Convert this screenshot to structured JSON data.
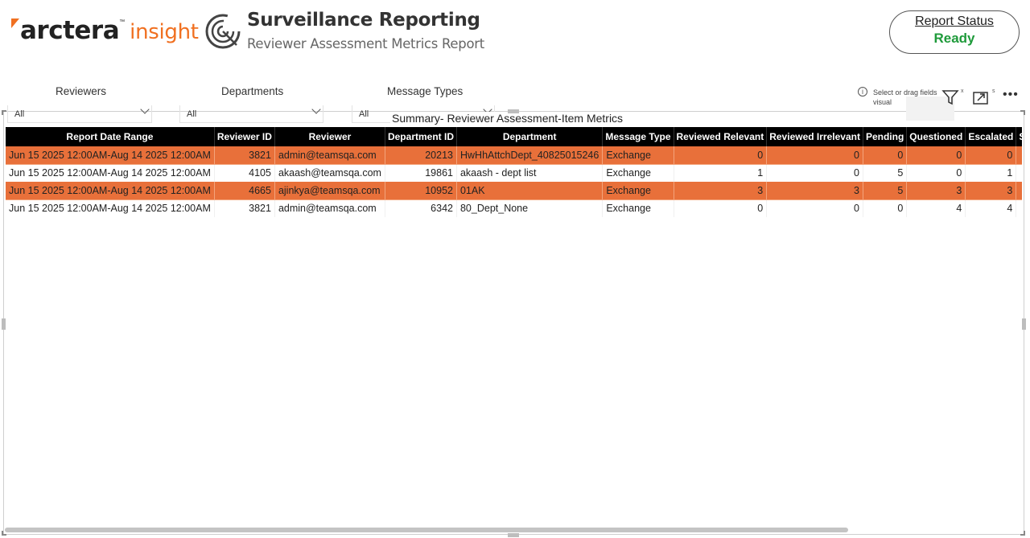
{
  "brand": {
    "name": "arctera",
    "tm": "™",
    "product": "insight",
    "accent": "#f07021"
  },
  "header": {
    "title": "Surveillance Reporting",
    "subtitle": "Reviewer Assessment Metrics Report",
    "icon": "radar-logo-icon"
  },
  "status": {
    "label": "Report Status",
    "value": "Ready",
    "value_color": "#1e9a3a"
  },
  "slicers": [
    {
      "title": "Reviewers",
      "value": "All"
    },
    {
      "title": "Departments",
      "value": "All"
    },
    {
      "title": "Message Types",
      "value": "All"
    }
  ],
  "visual": {
    "title": "Summary- Reviewer Assessment-Item Metrics",
    "hint_line1": "Select or drag fields",
    "hint_line2": "visual",
    "filter_label": "x",
    "focus_label": "s",
    "more_label": "•••"
  },
  "table": {
    "columns": [
      "Report Date Range",
      "Reviewer ID",
      "Reviewer",
      "Department ID",
      "Department",
      "Message Type",
      "Reviewed Relevant",
      "Reviewed Irrelevant",
      "Pending",
      "Questioned",
      "Escalated",
      "S"
    ],
    "highlight_color": "#e8703a",
    "rows": [
      {
        "highlight": true,
        "cells": [
          "Jun 15 2025 12:00AM-Aug 14 2025 12:00AM",
          "3821",
          "admin@teamsqa.com",
          "20213",
          "HwHhAttchDept_40825015246",
          "Exchange",
          "0",
          "0",
          "0",
          "0",
          "0",
          ""
        ]
      },
      {
        "highlight": false,
        "cells": [
          "Jun 15 2025 12:00AM-Aug 14 2025 12:00AM",
          "4105",
          "akaash@teamsqa.com",
          "19861",
          "akaash - dept list",
          "Exchange",
          "1",
          "0",
          "5",
          "0",
          "1",
          ""
        ]
      },
      {
        "highlight": true,
        "cells": [
          "Jun 15 2025 12:00AM-Aug 14 2025 12:00AM",
          "4665",
          "ajinkya@teamsqa.com",
          "10952",
          "01AK",
          "Exchange",
          "3",
          "3",
          "5",
          "3",
          "3",
          ""
        ]
      },
      {
        "highlight": false,
        "cells": [
          "Jun 15 2025 12:00AM-Aug 14 2025 12:00AM",
          "3821",
          "admin@teamsqa.com",
          "6342",
          "80_Dept_None",
          "Exchange",
          "0",
          "0",
          "0",
          "4",
          "4",
          ""
        ]
      }
    ]
  }
}
